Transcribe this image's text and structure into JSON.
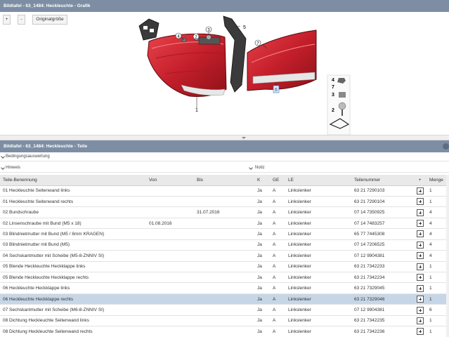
{
  "graphic_panel": {
    "title": "Bildtafel - 63_1484: Heckleuchte - Grafik",
    "zoom_in": "+",
    "zoom_out": "-",
    "original_size": "Originalgröße",
    "callouts": {
      "c1": "1",
      "c2": "2",
      "c3": "3",
      "c4": "4",
      "c5": "5",
      "c6": "6",
      "c7": "7"
    },
    "legend": {
      "n4": "4",
      "n7": "7",
      "n3": "3",
      "n2": "2"
    }
  },
  "parts_panel": {
    "title": "Bildtafel - 63_1484: Heckleuchte - Teile",
    "sections": {
      "conditions": "Bedingungsauswertung",
      "hints": "Hinweis",
      "notes": "Notiz"
    },
    "columns": [
      "Teile-Benennung",
      "Von",
      "Bis",
      "K",
      "GE",
      "LE",
      "Teilenummer",
      "+",
      "Menge"
    ],
    "rows": [
      {
        "name": "01 Heckleuchte Seitenwand links",
        "von": "",
        "bis": "",
        "k": "Ja",
        "ge": "A",
        "le": "Linkslenker",
        "part_no": "63 21 7290103",
        "qty": "1"
      },
      {
        "name": "01 Heckleuchte Seitenwand rechts",
        "von": "",
        "bis": "",
        "k": "Ja",
        "ge": "A",
        "le": "Linkslenker",
        "part_no": "63 21 7290104",
        "qty": "1"
      },
      {
        "name": "02 Bundschraube",
        "von": "",
        "bis": "31.07.2016",
        "k": "Ja",
        "ge": "A",
        "le": "Linkslenker",
        "part_no": "07 14 7350925",
        "qty": "4"
      },
      {
        "name": "02 Linsenschraube mit Bund (M5 x 18)",
        "von": "01.08.2016",
        "bis": "",
        "k": "Ja",
        "ge": "A",
        "le": "Linkslenker",
        "part_no": "07 14 7483257",
        "qty": "4"
      },
      {
        "name": "03 Blindnietmutter mit Bund (M5 / 8mm KRAGEN)",
        "von": "",
        "bis": "",
        "k": "Ja",
        "ge": "A",
        "le": "Linkslenker",
        "part_no": "65 77 7445308",
        "qty": "4"
      },
      {
        "name": "03 Blindnietmutter mit Bund (M5)",
        "von": "",
        "bis": "",
        "k": "Ja",
        "ge": "A",
        "le": "Linkslenker",
        "part_no": "07 14 7206525",
        "qty": "4"
      },
      {
        "name": "04 Sechskantmutter mit Scheibe (M5-8-ZNNIV SI)",
        "von": "",
        "bis": "",
        "k": "Ja",
        "ge": "A",
        "le": "Linkslenker",
        "part_no": "07 12 9904381",
        "qty": "4"
      },
      {
        "name": "05 Blende Heckleuchte Heckklappe links",
        "von": "",
        "bis": "",
        "k": "Ja",
        "ge": "A",
        "le": "Linkslenker",
        "part_no": "63 21 7342233",
        "qty": "1"
      },
      {
        "name": "05 Blende Heckleuchte Heckklappe rechts",
        "von": "",
        "bis": "",
        "k": "Ja",
        "ge": "A",
        "le": "Linkslenker",
        "part_no": "63 21 7342234",
        "qty": "1"
      },
      {
        "name": "06 Heckleuchte Heckklappe links",
        "von": "",
        "bis": "",
        "k": "Ja",
        "ge": "A",
        "le": "Linkslenker",
        "part_no": "63 21 7329045",
        "qty": "1"
      },
      {
        "name": "06 Heckleuchte Heckklappe rechts",
        "von": "",
        "bis": "",
        "k": "Ja",
        "ge": "A",
        "le": "Linkslenker",
        "part_no": "63 21 7329046",
        "qty": "1"
      },
      {
        "name": "07 Sechskantmutter mit Scheibe (M6-8-ZNNIV SI)",
        "von": "",
        "bis": "",
        "k": "Ja",
        "ge": "A",
        "le": "Linkslenker",
        "part_no": "07 12 9904381",
        "qty": "6"
      },
      {
        "name": "08 Dichtung Heckleuchte Seitenwand links",
        "von": "",
        "bis": "",
        "k": "Ja",
        "ge": "A",
        "le": "Linkslenker",
        "part_no": "63 21 7342235",
        "qty": "1"
      },
      {
        "name": "08 Dichtung Heckleuchte Seitenwand rechts",
        "von": "",
        "bis": "",
        "k": "Ja",
        "ge": "A",
        "le": "Linkslenker",
        "part_no": "63 21 7342236",
        "qty": "1"
      }
    ],
    "selected_row": 10
  },
  "colors": {
    "titlebar": "#7d8ea4",
    "selected_row": "#c7d6e6",
    "lamp_red": "#d42a36"
  }
}
